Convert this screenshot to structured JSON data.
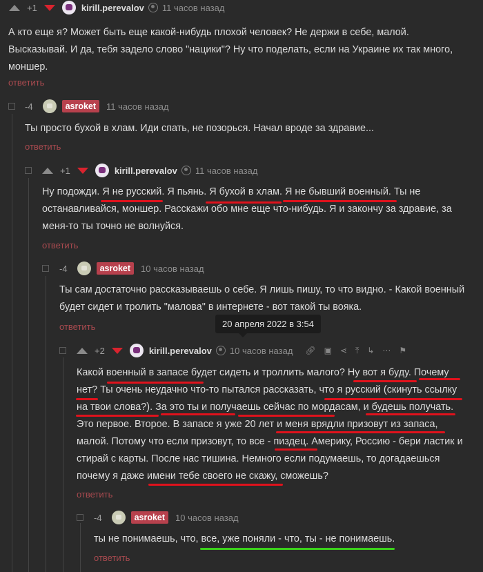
{
  "colors": {
    "background": "#2a2a2a",
    "downvote": "#d9232e",
    "reply": "#a84a4f",
    "badge": "#b7414d",
    "underline_red": "#e0121c",
    "underline_green": "#3bd11b"
  },
  "comments": [
    {
      "rating": "+1",
      "author": "kirill.perevalov",
      "time": "11 часов назад",
      "lines": [
        "А кто еще я? Может быть еще какой-нибудь плохой человек? Не держи в себе, малой.",
        "Высказывай. И да, тебя задело слово \"нацики\"? Ну что поделать, если на Украине их так много,",
        "моншер."
      ],
      "reply": "ответить"
    },
    {
      "rating": "-4",
      "author": "asroket",
      "time": "11 часов назад",
      "lines": [
        "Ты просто бухой в хлам. Иди спать, не позорься. Начал вроде за здравие..."
      ],
      "reply": "ответить"
    },
    {
      "rating": "+1",
      "author": "kirill.perevalov",
      "time": "11 часов назад",
      "lines": [
        "Ну подожди. Я не русский. Я пьянь. Я бухой в хлам. Я не бывший военный. Ты не",
        "останавливайся, моншер. Расскажи обо мне еще что-нибудь. Я и закончу за здравие, за",
        "меня-то ты точно не волнуйся."
      ],
      "reply": "ответить"
    },
    {
      "rating": "-4",
      "author": "asroket",
      "time": "10 часов назад",
      "lines": [
        "Ты сам достаточно рассказываешь о себе. Я лишь пишу, то что видно. - Какой военный",
        "будет сидет и тролить \"малова\" в интернете - вот такой ты вояка."
      ],
      "reply": "ответить"
    },
    {
      "rating": "+2",
      "author": "kirill.perevalov",
      "time": "10 часов назад",
      "lines": [
        "Какой военный в запасе будет сидеть и троллить малого? Ну вот я буду. Почему",
        "нет? Ты очень неудачно что-то пытался рассказать, что я русский (скинуть ссылку",
        "на твои слова?). За это ты и получаешь сейчас по мордасам, и будешь получать.",
        "Это первое. Второе. В запасе я уже 20 лет и меня врядли призовут из запаса,",
        "малой. Потому что если призовут, то все - пиздец. Америку, Россию - бери ластик и",
        "стирай с карты. После нас тишина. Немного если подумаешь, то догадаешься",
        "почему я даже имени тебе своего не скажу, сможешь?"
      ],
      "reply": "ответить"
    },
    {
      "rating": "-4",
      "author": "asroket",
      "time": "10 часов назад",
      "lines": [
        "ты не понимаешь, что, все, уже поняли - что, ты - не понимаешь."
      ],
      "reply": "ответить"
    }
  ],
  "tooltip": "20 апреля 2022 в 3:54",
  "tools": [
    "link-icon",
    "save-icon",
    "share-icon",
    "pin-icon",
    "branch-icon",
    "more-icon",
    "flag-icon"
  ]
}
